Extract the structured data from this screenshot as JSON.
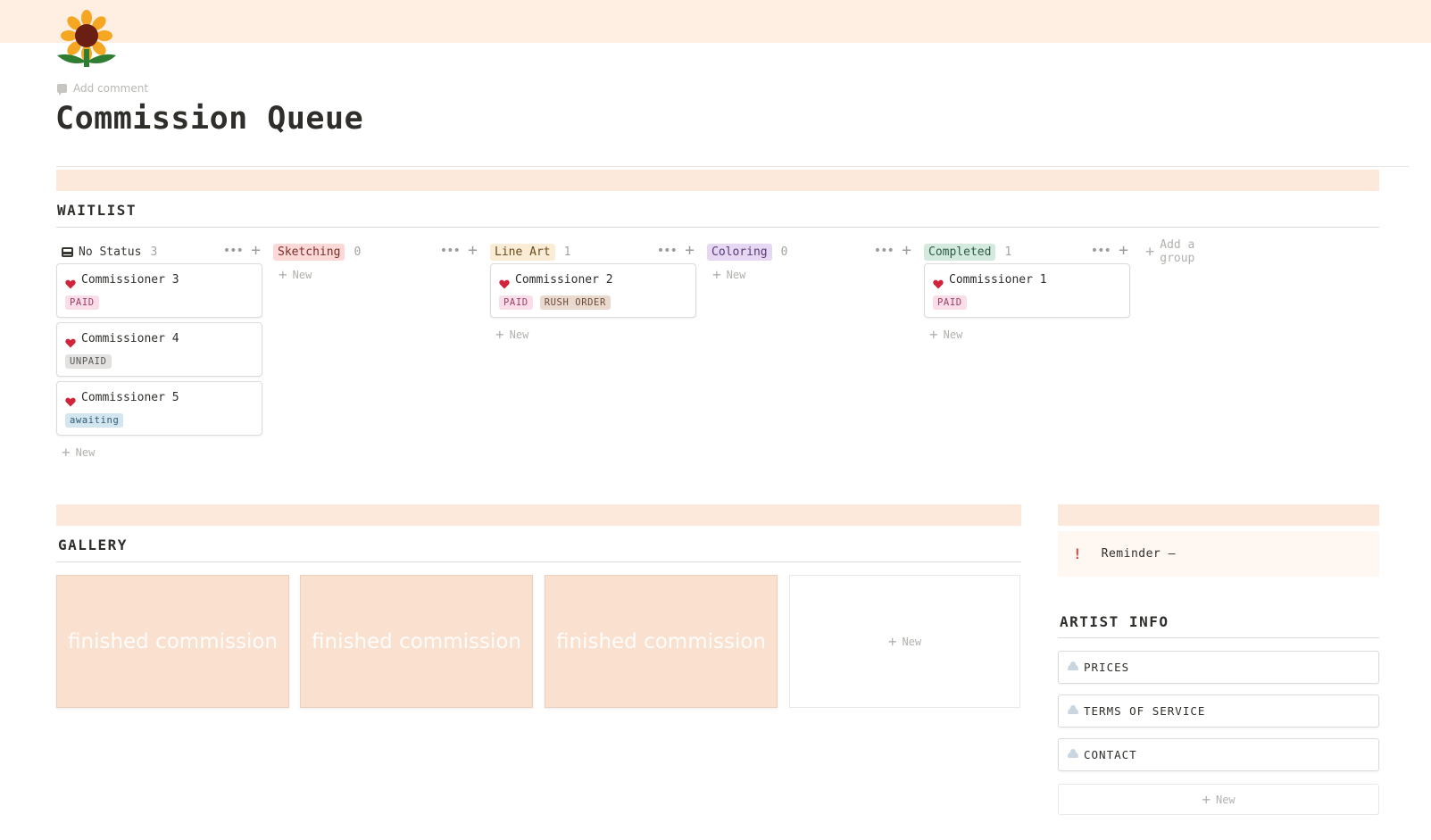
{
  "page": {
    "icon": "sunflower-icon",
    "add_comment": "Add comment",
    "title": "Commission Queue"
  },
  "waitlist": {
    "heading": "WAITLIST",
    "add_group": "Add a group",
    "new_label": "New",
    "columns": [
      {
        "label": "No Status",
        "count": "3",
        "color": "",
        "text_color": "#37352f",
        "cards": [
          {
            "name": "Commissioner 3",
            "tags": [
              {
                "text": "PAID",
                "bg": "#f9dde8",
                "fg": "#9b3f62"
              }
            ]
          },
          {
            "name": "Commissioner 4",
            "tags": [
              {
                "text": "UNPAID",
                "bg": "#e3e2e0",
                "fg": "#5a5955"
              }
            ]
          },
          {
            "name": "Commissioner 5",
            "tags": [
              {
                "text": "awaiting",
                "bg": "#d3e5ef",
                "fg": "#2f5b74"
              }
            ]
          }
        ]
      },
      {
        "label": "Sketching",
        "count": "0",
        "color": "#fcd9d6",
        "text_color": "#7a2e2a",
        "cards": []
      },
      {
        "label": "Line Art",
        "count": "1",
        "color": "#fbecd5",
        "text_color": "#6a4a1b",
        "cards": [
          {
            "name": "Commissioner 2",
            "tags": [
              {
                "text": "PAID",
                "bg": "#f9dde8",
                "fg": "#9b3f62"
              },
              {
                "text": "RUSH ORDER",
                "bg": "#ead9cf",
                "fg": "#6b4a38"
              }
            ]
          }
        ]
      },
      {
        "label": "Coloring",
        "count": "0",
        "color": "#e6d7f2",
        "text_color": "#5b3a78",
        "cards": []
      },
      {
        "label": "Completed",
        "count": "1",
        "color": "#d4eadf",
        "text_color": "#2d5d45",
        "cards": [
          {
            "name": "Commissioner 1",
            "tags": [
              {
                "text": "PAID",
                "bg": "#f9dde8",
                "fg": "#9b3f62"
              }
            ]
          }
        ]
      }
    ]
  },
  "gallery": {
    "heading": "GALLERY",
    "cards": [
      "finished commission",
      "finished commission",
      "finished commission"
    ],
    "new_label": "New"
  },
  "sidebar": {
    "reminder": "Reminder —",
    "artist_info_heading": "ARTIST INFO",
    "items": [
      "PRICES",
      "TERMS OF SERVICE",
      "CONTACT"
    ],
    "new_label": "New"
  },
  "colors": {
    "cover": "#ffeee2",
    "band": "#fde8dc",
    "gallery_card": "#fae0cf",
    "heart": "#d1243a"
  }
}
